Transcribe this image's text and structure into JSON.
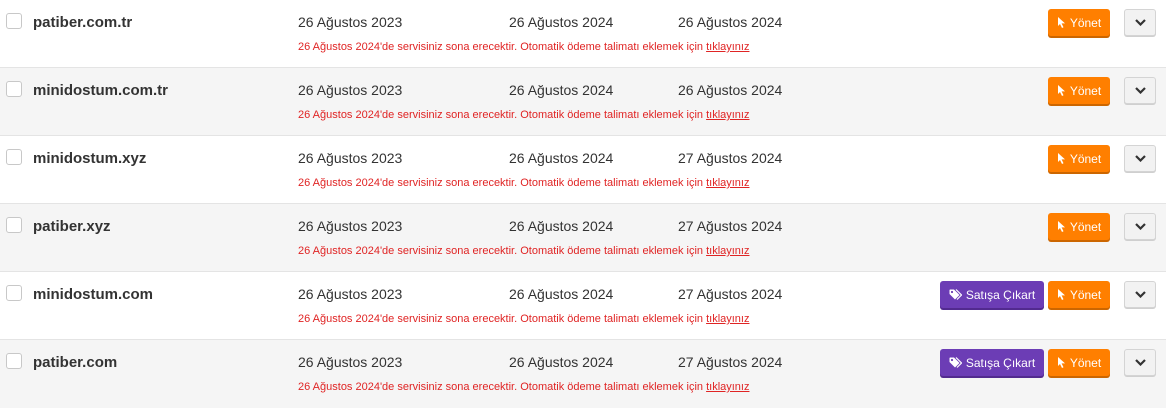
{
  "rows": [
    {
      "domain": "patiber.com.tr",
      "date1": "26 Ağustos 2023",
      "date2": "26 Ağustos 2024",
      "date3": "26 Ağustos 2024",
      "notice": "26 Ağustos 2024'de servisiniz sona erecektir. Otomatik ödeme talimatı eklemek için ",
      "notice_link": "tıklayınız",
      "manage_label": "Yönet"
    },
    {
      "domain": "minidostum.com.tr",
      "date1": "26 Ağustos 2023",
      "date2": "26 Ağustos 2024",
      "date3": "26 Ağustos 2024",
      "notice": "26 Ağustos 2024'de servisiniz sona erecektir. Otomatik ödeme talimatı eklemek için ",
      "notice_link": "tıklayınız",
      "manage_label": "Yönet"
    },
    {
      "domain": "minidostum.xyz",
      "date1": "26 Ağustos 2023",
      "date2": "26 Ağustos 2024",
      "date3": "27 Ağustos 2024",
      "notice": "26 Ağustos 2024'de servisiniz sona erecektir. Otomatik ödeme talimatı eklemek için ",
      "notice_link": "tıklayınız",
      "manage_label": "Yönet"
    },
    {
      "domain": "patiber.xyz",
      "date1": "26 Ağustos 2023",
      "date2": "26 Ağustos 2024",
      "date3": "27 Ağustos 2024",
      "notice": "26 Ağustos 2024'de servisiniz sona erecektir. Otomatik ödeme talimatı eklemek için ",
      "notice_link": "tıklayınız",
      "manage_label": "Yönet"
    },
    {
      "domain": "minidostum.com",
      "date1": "26 Ağustos 2023",
      "date2": "26 Ağustos 2024",
      "date3": "27 Ağustos 2024",
      "notice": "26 Ağustos 2024'de servisiniz sona erecektir. Otomatik ödeme talimatı eklemek için ",
      "notice_link": "tıklayınız",
      "manage_label": "Yönet",
      "sale_label": "Satışa Çıkart"
    },
    {
      "domain": "patiber.com",
      "date1": "26 Ağustos 2023",
      "date2": "26 Ağustos 2024",
      "date3": "27 Ağustos 2024",
      "notice": "26 Ağustos 2024'de servisiniz sona erecektir. Otomatik ödeme talimatı eklemek için ",
      "notice_link": "tıklayınız",
      "manage_label": "Yönet",
      "sale_label": "Satışa Çıkart"
    }
  ],
  "icons": {
    "manage": "cursor-pointer-icon",
    "sale": "tag-icon",
    "expand": "chevron-down-icon"
  },
  "colors": {
    "manage_button": "#ff7f00",
    "sale_button": "#6c3db5",
    "notice_text": "#e02424"
  }
}
